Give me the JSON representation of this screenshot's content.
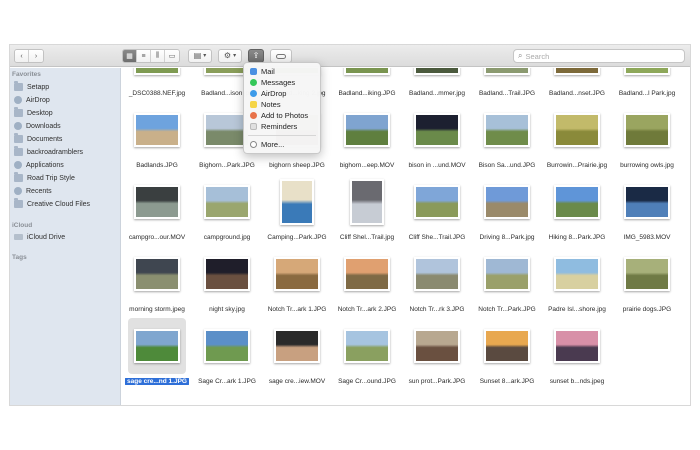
{
  "toolbar": {
    "back_icon": "chevron-left-icon",
    "forward_icon": "chevron-right-icon",
    "search_placeholder": "Search"
  },
  "sidebar": {
    "favorites_header": "Favorites",
    "favorites": [
      {
        "label": "Setapp",
        "icon": "folder-icon"
      },
      {
        "label": "AirDrop",
        "icon": "airdrop-icon"
      },
      {
        "label": "Desktop",
        "icon": "desktop-icon"
      },
      {
        "label": "Downloads",
        "icon": "downloads-icon"
      },
      {
        "label": "Documents",
        "icon": "documents-icon"
      },
      {
        "label": "backroadramblers",
        "icon": "home-icon"
      },
      {
        "label": "Applications",
        "icon": "applications-icon"
      },
      {
        "label": "Road Trip Style",
        "icon": "folder-icon"
      },
      {
        "label": "Recents",
        "icon": "recents-icon"
      },
      {
        "label": "Creative Cloud Files",
        "icon": "folder-icon"
      }
    ],
    "icloud_header": "iCloud",
    "icloud": [
      {
        "label": "iCloud Drive",
        "icon": "cloud-icon"
      }
    ],
    "tags_header": "Tags"
  },
  "share_menu": {
    "items": [
      {
        "label": "Mail",
        "icon": "mail-icon",
        "color": "#4a90e2"
      },
      {
        "label": "Messages",
        "icon": "messages-icon",
        "color": "#34c759"
      },
      {
        "label": "AirDrop",
        "icon": "airdrop-icon",
        "color": "#3d9be9"
      },
      {
        "label": "Notes",
        "icon": "notes-icon",
        "color": "#f5d547"
      },
      {
        "label": "Add to Photos",
        "icon": "photos-icon",
        "color": "#e8734a"
      },
      {
        "label": "Reminders",
        "icon": "reminders-icon",
        "color": "#e0e0e0"
      }
    ],
    "more_label": "More..."
  },
  "files": [
    {
      "name": "_DSC0388.NEF.jpg",
      "colors": [
        "#b7c8a4",
        "#7f9b52"
      ]
    },
    {
      "name": "Badland...ison.jpg",
      "colors": [
        "#c6d3c8",
        "#8a9e5a"
      ]
    },
    {
      "name": "Badland...king 2.jpg",
      "colors": [
        "#a9b99a",
        "#6f8a45"
      ]
    },
    {
      "name": "Badland...iking.JPG",
      "colors": [
        "#b3c0a0",
        "#7a9550"
      ]
    },
    {
      "name": "Badland...mmer.jpg",
      "colors": [
        "#6a7e9a",
        "#4b5a3d"
      ]
    },
    {
      "name": "Badland...Trail.JPG",
      "colors": [
        "#c0c8b8",
        "#8b9a70"
      ]
    },
    {
      "name": "Badland...nset.JPG",
      "colors": [
        "#d9b86a",
        "#7d6a3a"
      ]
    },
    {
      "name": "Badland...l Park.jpg",
      "colors": [
        "#5f9be0",
        "#8ea85a"
      ]
    },
    {
      "name": "Badlands.JPG",
      "colors": [
        "#6ea3de",
        "#c9b08a"
      ]
    },
    {
      "name": "Bighorn...Park.JPG",
      "colors": [
        "#b8c7d8",
        "#7a8a6a"
      ]
    },
    {
      "name": "bighorn sheep.JPG",
      "colors": [
        "#8d9a7a",
        "#5a5446"
      ]
    },
    {
      "name": "bighorn...eep.MOV",
      "colors": [
        "#7fa4d0",
        "#5f7f3f"
      ]
    },
    {
      "name": "bison in ...und.MOV",
      "colors": [
        "#1c2030",
        "#6a8a4a"
      ]
    },
    {
      "name": "Bison Sa...und.JPG",
      "colors": [
        "#a7c0d8",
        "#6f8c4a"
      ]
    },
    {
      "name": "Burrowin...Prairie.jpg",
      "colors": [
        "#c2ba6a",
        "#8a8a3a"
      ]
    },
    {
      "name": "burrowing owls.jpg",
      "colors": [
        "#9aa560",
        "#6f7a3a"
      ]
    },
    {
      "name": "campgro...our.MOV",
      "colors": [
        "#3a3f40",
        "#8c9a90"
      ]
    },
    {
      "name": "campground.jpg",
      "colors": [
        "#a6bfd8",
        "#9aa66e"
      ]
    },
    {
      "name": "Camping...Park.JPG",
      "colors": [
        "#e8e0c8",
        "#3a7ab8"
      ],
      "portrait": true
    },
    {
      "name": "Cliff Shel...Trail.jpg",
      "colors": [
        "#6a6a70",
        "#c7ccd4"
      ],
      "portrait": true
    },
    {
      "name": "Cliff She...Trail.JPG",
      "colors": [
        "#7fa6d8",
        "#8a9a5a"
      ]
    },
    {
      "name": "Driving 8...Park.jpg",
      "colors": [
        "#6f9ad8",
        "#9a8a6a"
      ]
    },
    {
      "name": "Hiking 8...Park.JPG",
      "colors": [
        "#5f95d8",
        "#6a8a4a"
      ]
    },
    {
      "name": "IMG_5983.MOV",
      "colors": [
        "#1a2a45",
        "#4f7fb8"
      ]
    },
    {
      "name": "morning storm.jpeg",
      "colors": [
        "#3f4650",
        "#8a8f70"
      ]
    },
    {
      "name": "night sky.jpg",
      "colors": [
        "#1f1e2a",
        "#6a5040"
      ]
    },
    {
      "name": "Notch Tr...ark 1.JPG",
      "colors": [
        "#d6a878",
        "#8a6a40"
      ]
    },
    {
      "name": "Notch Tr...ark 2.JPG",
      "colors": [
        "#e0a070",
        "#7f6a45"
      ]
    },
    {
      "name": "Notch Tr...rk 3.JPG",
      "colors": [
        "#b0c4dc",
        "#8a8a70"
      ]
    },
    {
      "name": "Notch Tr...Park.JPG",
      "colors": [
        "#9fb8d4",
        "#9aa06a"
      ]
    },
    {
      "name": "Padre Isl...shore.jpg",
      "colors": [
        "#8fbce0",
        "#d8d0a0"
      ]
    },
    {
      "name": "prairie dogs.JPG",
      "colors": [
        "#a7b07a",
        "#6f7a45"
      ]
    },
    {
      "name": "sage cre...nd 1.JPG",
      "colors": [
        "#7fa6cf",
        "#4e8a3a"
      ],
      "selected": true
    },
    {
      "name": "Sage Cr...ark 1.JPG",
      "colors": [
        "#5b8fc8",
        "#6f9a50"
      ]
    },
    {
      "name": "sage cre...iew.MOV",
      "colors": [
        "#2a2a2a",
        "#c8a080"
      ]
    },
    {
      "name": "Sage Cr...ound.JPG",
      "colors": [
        "#a6c4e0",
        "#8aa060"
      ]
    },
    {
      "name": "sun prot...Park.JPG",
      "colors": [
        "#b8a890",
        "#6a5040"
      ]
    },
    {
      "name": "Sunset 8...ark.JPG",
      "colors": [
        "#e8a850",
        "#5a4a40"
      ]
    },
    {
      "name": "sunset b...nds.jpeg",
      "colors": [
        "#d890a8",
        "#4a3a50"
      ]
    }
  ]
}
